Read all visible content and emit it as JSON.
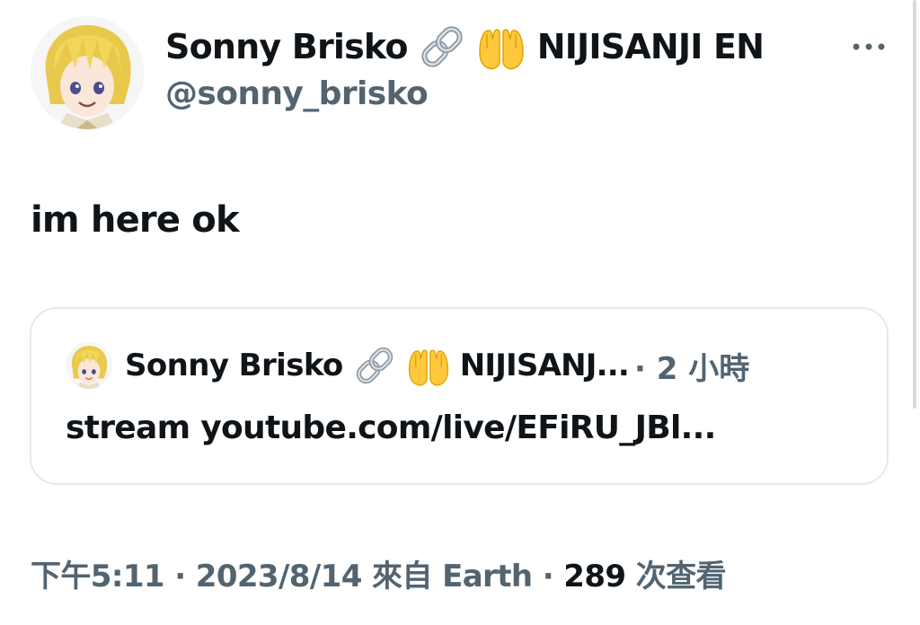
{
  "author": {
    "display_name": "Sonny Brisko",
    "name_suffix": "NIJISANJI EN",
    "emoji_1": "link-emoji",
    "emoji_2": "raised-hands-emoji",
    "handle": "@sonny_brisko"
  },
  "tweet": {
    "text": "im here ok"
  },
  "quote": {
    "display_name": "Sonny Brisko",
    "name_suffix": "NIJISANJ...",
    "time": "· 2 小時",
    "text": "stream youtube.com/live/EFiRU_JBl..."
  },
  "meta": {
    "time": "下午5:11 · 2023/8/14 來自 Earth ·",
    "views_count": "289",
    "views_label": "次查看"
  },
  "colors": {
    "text_primary": "#0f1419",
    "text_secondary": "#536471",
    "border": "#e6e9ec"
  }
}
